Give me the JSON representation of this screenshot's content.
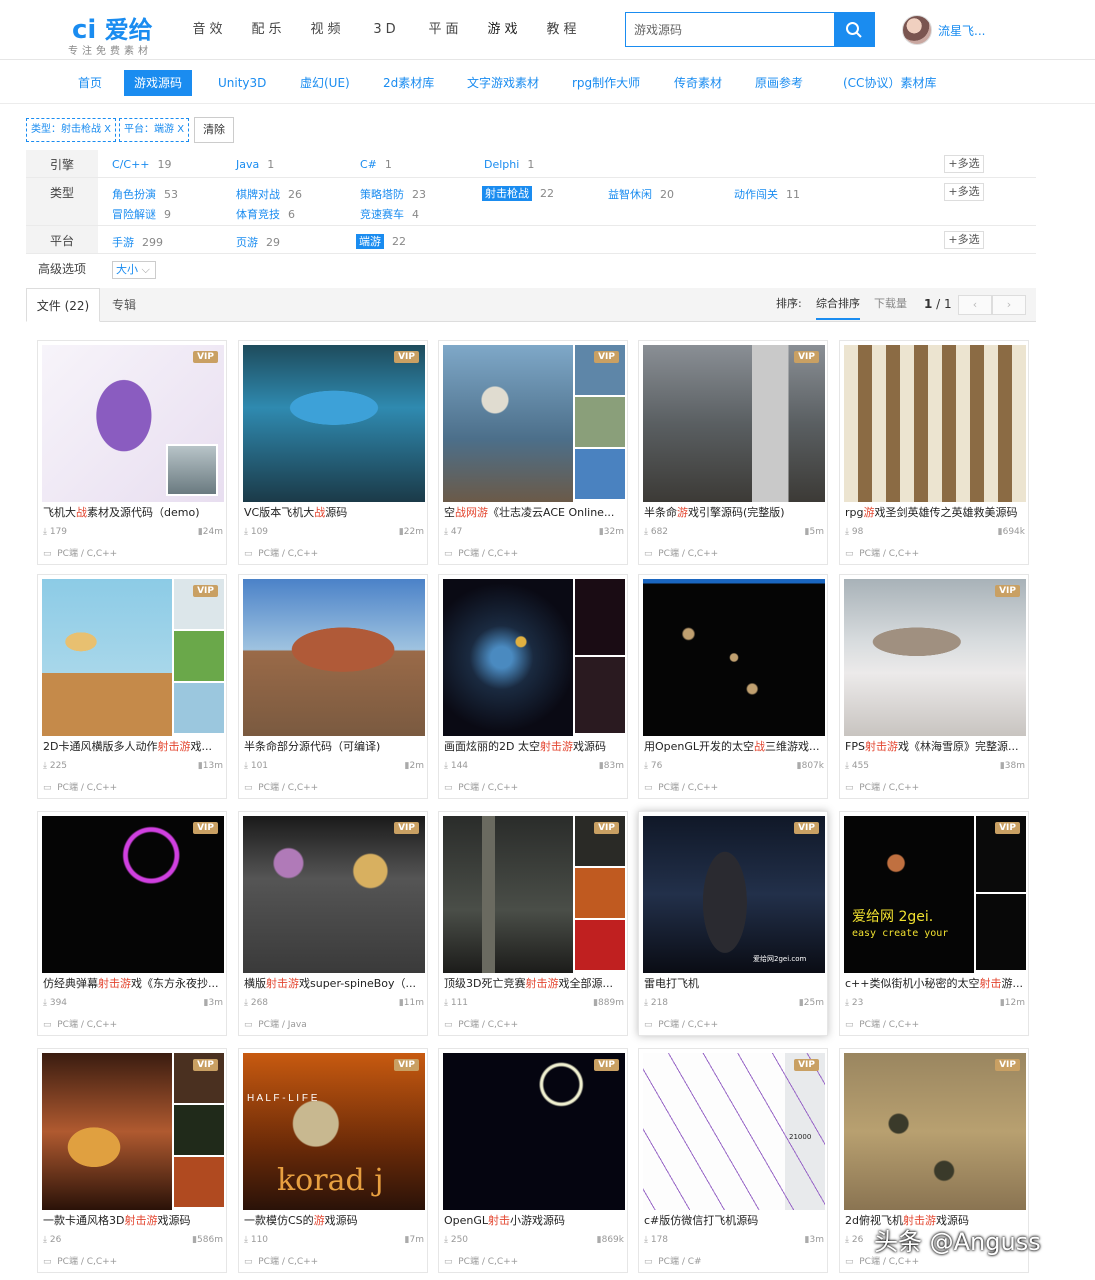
{
  "logo": {
    "brand": "爱给",
    "tagline": "专注免费素材"
  },
  "topnav": [
    "音效",
    "配乐",
    "视频",
    "3D",
    "平面",
    "游戏",
    "教程"
  ],
  "search": {
    "value": "游戏源码"
  },
  "user": {
    "name": "流星飞..."
  },
  "subnav": [
    {
      "label": "首页",
      "x": 0
    },
    {
      "label": "游戏源码"
    },
    {
      "label": "Unity3D"
    },
    {
      "label": "虚幻(UE)"
    },
    {
      "label": "2d素材库"
    },
    {
      "label": "文字游戏素材"
    },
    {
      "label": "rpg制作大师"
    },
    {
      "label": "传奇素材"
    },
    {
      "label": "原画参考"
    },
    {
      "label": "(CC协议）素材库"
    }
  ],
  "chips": [
    "类型：射击枪战 X",
    "平台：端游 X"
  ],
  "clear_label": "清除",
  "filters": {
    "engine": {
      "label": "引擎",
      "options": [
        {
          "name": "C/C++",
          "count": "19"
        },
        {
          "name": "Java",
          "count": "1"
        },
        {
          "name": "C#",
          "count": "1"
        },
        {
          "name": "Delphi",
          "count": "1"
        }
      ]
    },
    "type": {
      "label": "类型",
      "options": [
        {
          "name": "角色扮演",
          "count": "53"
        },
        {
          "name": "棋牌对战",
          "count": "26"
        },
        {
          "name": "策略塔防",
          "count": "23"
        },
        {
          "name": "射击枪战",
          "count": "22"
        },
        {
          "name": "益智休闲",
          "count": "20"
        },
        {
          "name": "动作闯关",
          "count": "11"
        },
        {
          "name": "冒险解谜",
          "count": "9"
        },
        {
          "name": "体育竞技",
          "count": "6"
        },
        {
          "name": "竞速赛车",
          "count": "4"
        }
      ]
    },
    "platform": {
      "label": "平台",
      "options": [
        {
          "name": "手游",
          "count": "299"
        },
        {
          "name": "页游",
          "count": "29"
        },
        {
          "name": "端游",
          "count": "22"
        }
      ]
    },
    "advanced": {
      "label": "高级选项",
      "size": "大小"
    },
    "multi_label": "+多选"
  },
  "tabs": {
    "files": "文件 (22)",
    "albums": "专辑"
  },
  "sort": {
    "label": "排序:",
    "options": [
      "综合排序",
      "下载量"
    ]
  },
  "pager": {
    "current": "1",
    "total": "1"
  },
  "cards": [
    {
      "title_pre": "飞机大",
      "hl": "战",
      "title_post": "素材及源代码（demo)",
      "downloads": "179",
      "size": "24m",
      "platform": "PC端 / C,C++",
      "vip": "VIP"
    },
    {
      "title_pre": "VC版本飞机大",
      "hl": "战",
      "title_post": "源码",
      "downloads": "109",
      "size": "22m",
      "platform": "PC端 / C,C++",
      "vip": "VIP"
    },
    {
      "title_pre": "空",
      "hl": "战网游",
      "title_post": "《壮志凌云ACE Online...",
      "downloads": "47",
      "size": "32m",
      "platform": "PC端 / C,C++",
      "vip": "VIP"
    },
    {
      "title_pre": "半条命",
      "hl": "游",
      "title_post": "戏引擎源码(完整版)",
      "downloads": "682",
      "size": "5m",
      "platform": "PC端 / C,C++",
      "vip": "VIP"
    },
    {
      "title_pre": "rpg",
      "hl": "游",
      "title_post": "戏圣剑英雄传之英雄救美源码",
      "downloads": "98",
      "size": "694k",
      "platform": "PC端 / C,C++",
      "vip": ""
    },
    {
      "title_pre": "2D卡通风横版多人动作",
      "hl": "射击游",
      "title_post": "戏...",
      "downloads": "225",
      "size": "13m",
      "platform": "PC端 / C,C++",
      "vip": "VIP"
    },
    {
      "title_pre": "半条命部分源代码（可编译)",
      "hl": "",
      "title_post": "",
      "downloads": "101",
      "size": "2m",
      "platform": "PC端 / C,C++",
      "vip": ""
    },
    {
      "title_pre": "画面炫丽的2D 太空",
      "hl": "射击游",
      "title_post": "戏源码",
      "downloads": "144",
      "size": "83m",
      "platform": "PC端 / C,C++",
      "vip": ""
    },
    {
      "title_pre": "用OpenGL开发的太空",
      "hl": "战",
      "title_post": "三维游戏...",
      "downloads": "76",
      "size": "807k",
      "platform": "PC端 / C,C++",
      "vip": ""
    },
    {
      "title_pre": "FPS",
      "hl": "射击游",
      "title_post": "戏《林海雪原》完整源...",
      "downloads": "455",
      "size": "38m",
      "platform": "PC端 / C,C++",
      "vip": "VIP"
    },
    {
      "title_pre": "仿经典弹幕",
      "hl": "射击游",
      "title_post": "戏《东方永夜抄...",
      "downloads": "394",
      "size": "3m",
      "platform": "PC端 / C,C++",
      "vip": "VIP"
    },
    {
      "title_pre": "横版",
      "hl": "射击游",
      "title_post": "戏super-spineBoy（...",
      "downloads": "268",
      "size": "11m",
      "platform": "PC端 / Java",
      "vip": "VIP"
    },
    {
      "title_pre": "顶级3D死亡竞赛",
      "hl": "射击游",
      "title_post": "戏全部源...",
      "downloads": "111",
      "size": "889m",
      "platform": "PC端 / C,C++",
      "vip": "VIP"
    },
    {
      "title_pre": "雷电打飞机",
      "hl": "",
      "title_post": "",
      "downloads": "218",
      "size": "25m",
      "platform": "PC端 / C,C++",
      "vip": "VIP"
    },
    {
      "title_pre": "c++类似街机小秘密的太空",
      "hl": "射击",
      "title_post": "游...",
      "downloads": "23",
      "size": "12m",
      "platform": "PC端 / C,C++",
      "vip": "VIP"
    },
    {
      "title_pre": "一款卡通风格3D",
      "hl": "射击游",
      "title_post": "戏源码",
      "downloads": "26",
      "size": "586m",
      "platform": "PC端 / C,C++",
      "vip": "VIP"
    },
    {
      "title_pre": "一款模仿CS的",
      "hl": "游",
      "title_post": "戏源码",
      "downloads": "110",
      "size": "7m",
      "platform": "PC端 / C,C++",
      "vip": "VIP"
    },
    {
      "title_pre": "OpenGL",
      "hl": "射击",
      "title_post": "小游戏源码",
      "downloads": "250",
      "size": "869k",
      "platform": "PC端 / C,C++",
      "vip": "VIP"
    },
    {
      "title_pre": "c#版仿微信打飞机源码",
      "hl": "",
      "title_post": "",
      "downloads": "178",
      "size": "3m",
      "platform": "PC端 / C#",
      "vip": "VIP"
    },
    {
      "title_pre": "2d俯视飞机",
      "hl": "射击游",
      "title_post": "戏源码",
      "downloads": "26",
      "size": "",
      "platform": "PC端 / C,C++",
      "vip": "VIP"
    }
  ],
  "thumb_text": {
    "card2_game": "爱给网 2gei.",
    "card2_sub": "easy create your",
    "card17_title": "H A L F - L I F E",
    "card17_logo": "korad j",
    "card13_site": "爱给网2gei.com",
    "card19_score": "21000"
  },
  "watermark": "头条 @Anguss"
}
